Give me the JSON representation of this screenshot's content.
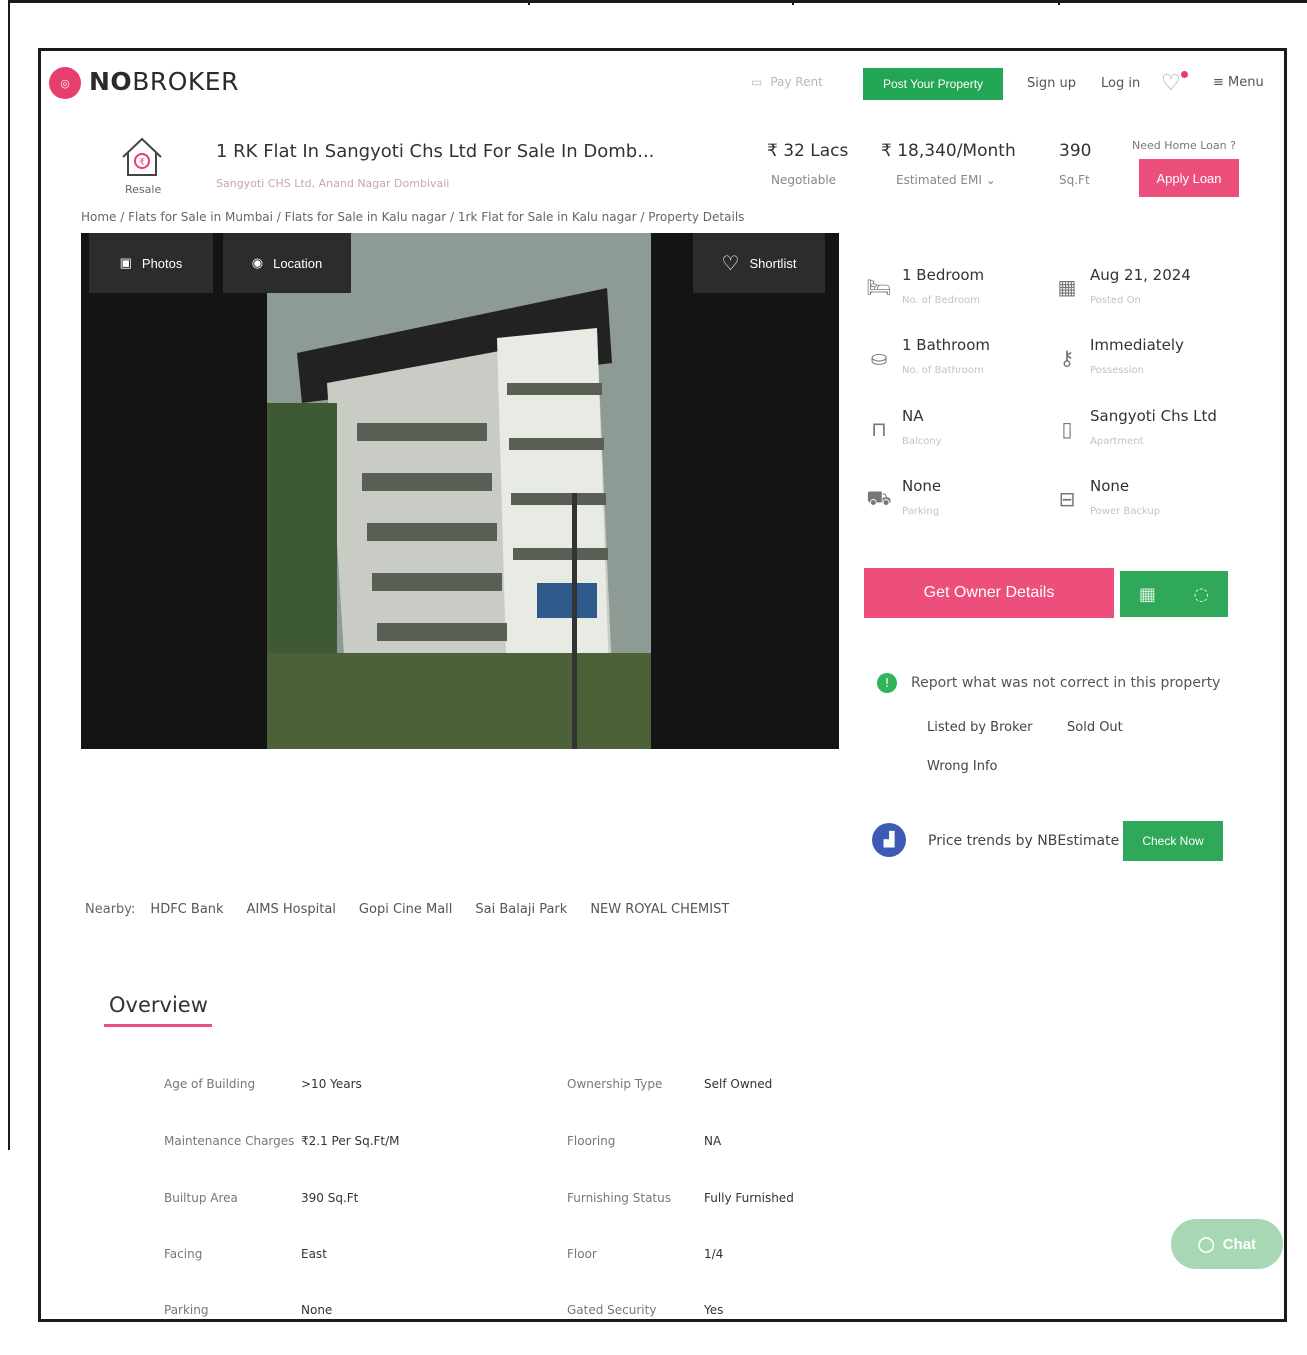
{
  "header": {
    "logo_text_bold": "NO",
    "logo_text_rest": "BROKER",
    "pay_rent": "Pay Rent",
    "post_property": "Post Your Property",
    "sign_up": "Sign up",
    "log_in": "Log in",
    "menu": "Menu"
  },
  "listing": {
    "type_badge": "Resale",
    "title": "1 RK Flat In Sangyoti Chs Ltd For Sale In Domb...",
    "subtitle": "Sangyoti CHS Ltd, Anand Nagar Dombivali",
    "price": "₹ 32 Lacs",
    "price_sub": "Negotiable",
    "emi": "₹ 18,340/Month",
    "emi_sub": "Estimated EMI",
    "area": "390",
    "area_sub": "Sq.Ft",
    "loan_question": "Need Home Loan ?",
    "apply_loan": "Apply Loan"
  },
  "breadcrumb": "Home / Flats for Sale in Mumbai / Flats for Sale in Kalu nagar / 1rk Flat for Sale in Kalu nagar / Property Details",
  "gallery": {
    "photos": "Photos",
    "location": "Location",
    "shortlist": "Shortlist"
  },
  "facts": [
    {
      "value": "1 Bedroom",
      "label": "No. of Bedroom"
    },
    {
      "value": "Aug 21, 2024",
      "label": "Posted On"
    },
    {
      "value": "1 Bathroom",
      "label": "No. of Bathroom"
    },
    {
      "value": "Immediately",
      "label": "Possession"
    },
    {
      "value": "NA",
      "label": "Balcony"
    },
    {
      "value": "Sangyoti Chs Ltd",
      "label": "Apartment"
    },
    {
      "value": "None",
      "label": "Parking"
    },
    {
      "value": "None",
      "label": "Power Backup"
    }
  ],
  "actions": {
    "get_owner": "Get Owner Details"
  },
  "report": {
    "text": "Report what was not correct in this property",
    "tags": [
      "Listed by Broker",
      "Sold Out",
      "Wrong Info"
    ]
  },
  "trends": {
    "text": "Price trends by NBEstimate",
    "button": "Check Now"
  },
  "nearby": {
    "label": "Nearby:",
    "places": [
      "HDFC Bank",
      "AIMS Hospital",
      "Gopi Cine Mall",
      "Sai Balaji Park",
      "NEW ROYAL CHEMIST"
    ]
  },
  "overview": {
    "title": "Overview",
    "left": [
      {
        "label": "Age of Building",
        "value": ">10 Years"
      },
      {
        "label": "Maintenance Charges",
        "value": "₹2.1 Per Sq.Ft/M"
      },
      {
        "label": "Builtup Area",
        "value": "390 Sq.Ft"
      },
      {
        "label": "Facing",
        "value": "East"
      },
      {
        "label": "Parking",
        "value": "None"
      }
    ],
    "right": [
      {
        "label": "Ownership Type",
        "value": "Self Owned"
      },
      {
        "label": "Flooring",
        "value": "NA"
      },
      {
        "label": "Furnishing Status",
        "value": "Fully Furnished"
      },
      {
        "label": "Floor",
        "value": "1/4"
      },
      {
        "label": "Gated Security",
        "value": "Yes"
      }
    ]
  },
  "chat": "Chat",
  "colors": {
    "brand_pink": "#ec4f7c",
    "brand_green": "#2fa85a",
    "estimate_blue": "#3d5bb5"
  }
}
